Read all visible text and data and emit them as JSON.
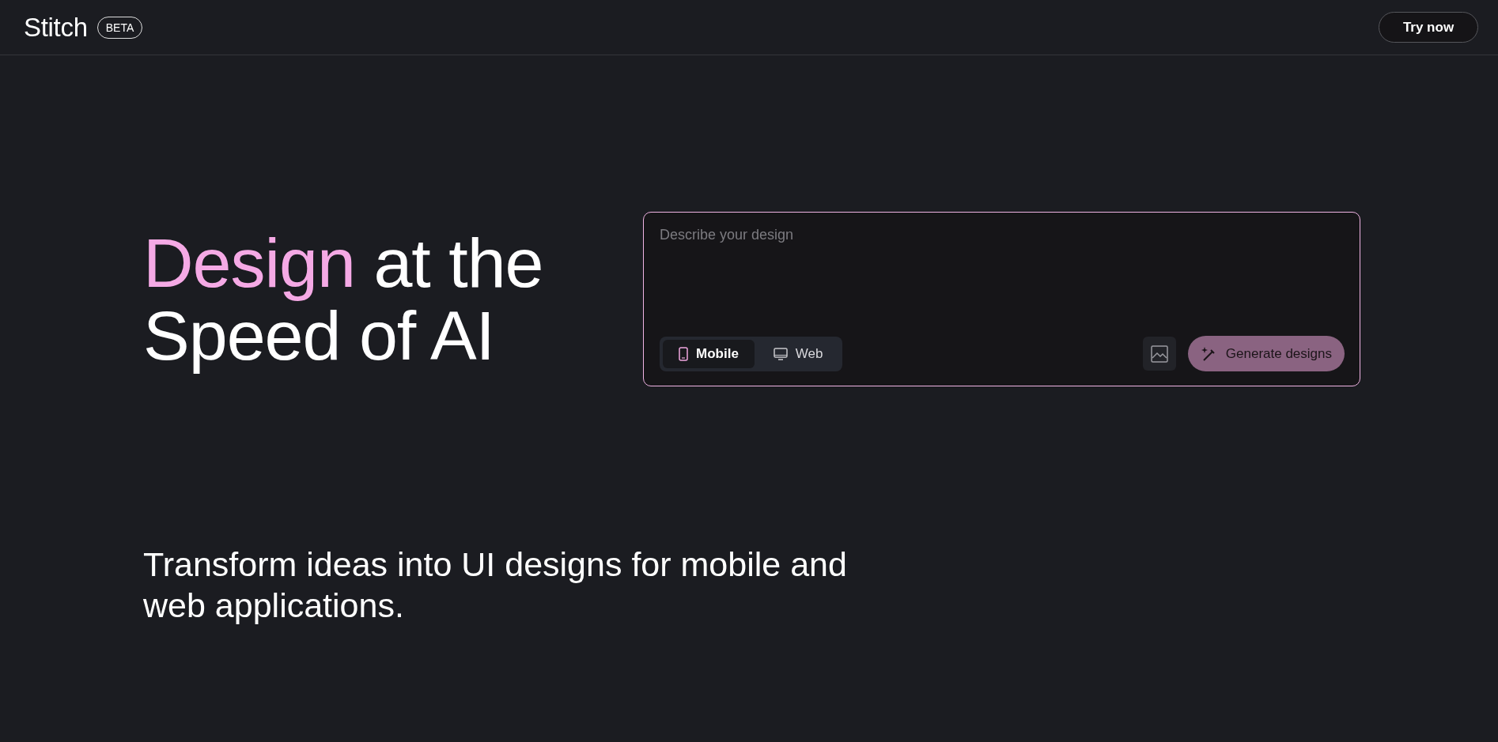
{
  "header": {
    "logo": "Stitch",
    "badge": "BETA",
    "cta": "Try now"
  },
  "hero": {
    "headline": {
      "accent": "Design",
      "rest": "at the Speed of AI"
    },
    "prompt": {
      "placeholder": "Describe your design",
      "modes": [
        {
          "label": "Mobile",
          "kind": "phone",
          "selected": true
        },
        {
          "label": "Web",
          "kind": "desktop",
          "selected": false
        }
      ],
      "generate": "Generate designs"
    }
  },
  "subtitle": "Transform ideas into UI designs for mobile and web applications."
}
